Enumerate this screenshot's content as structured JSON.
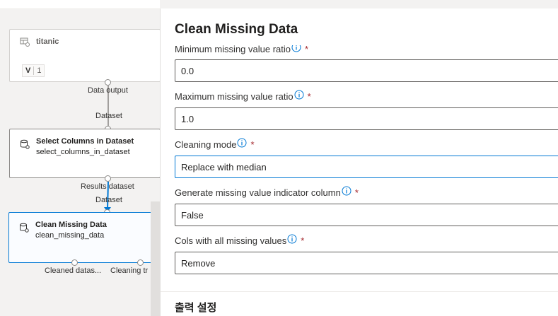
{
  "canvas": {
    "nodes": {
      "dataset": {
        "title": "titanic",
        "version_label": "V",
        "version_number": "1"
      },
      "select_columns": {
        "title": "Select Columns in Dataset",
        "subtitle": "select_columns_in_dataset"
      },
      "clean_missing": {
        "title": "Clean Missing Data",
        "subtitle": "clean_missing_data"
      }
    },
    "ports": {
      "data_output": "Data output",
      "dataset_in_1": "Dataset",
      "results_dataset": "Results dataset",
      "dataset_in_2": "Dataset",
      "cleaned_dataset": "Cleaned datas...",
      "cleaning_transformation": "Cleaning tr"
    }
  },
  "panel": {
    "title": "Clean Missing Data",
    "fields": [
      {
        "label": "Minimum missing value ratio",
        "value": "0.0"
      },
      {
        "label": "Maximum missing value ratio",
        "value": "1.0"
      },
      {
        "label": "Cleaning mode",
        "value": "Replace with median"
      },
      {
        "label": "Generate missing value indicator column",
        "value": "False"
      },
      {
        "label": "Cols with all missing values",
        "value": "Remove"
      }
    ],
    "required_marker": "*",
    "section_title": "출력 설정"
  },
  "colors": {
    "accent": "#0078d4",
    "required": "#a4262c",
    "edge": "#a19f9d"
  },
  "icons": [
    "dataset-icon",
    "module-icon",
    "info-icon"
  ]
}
